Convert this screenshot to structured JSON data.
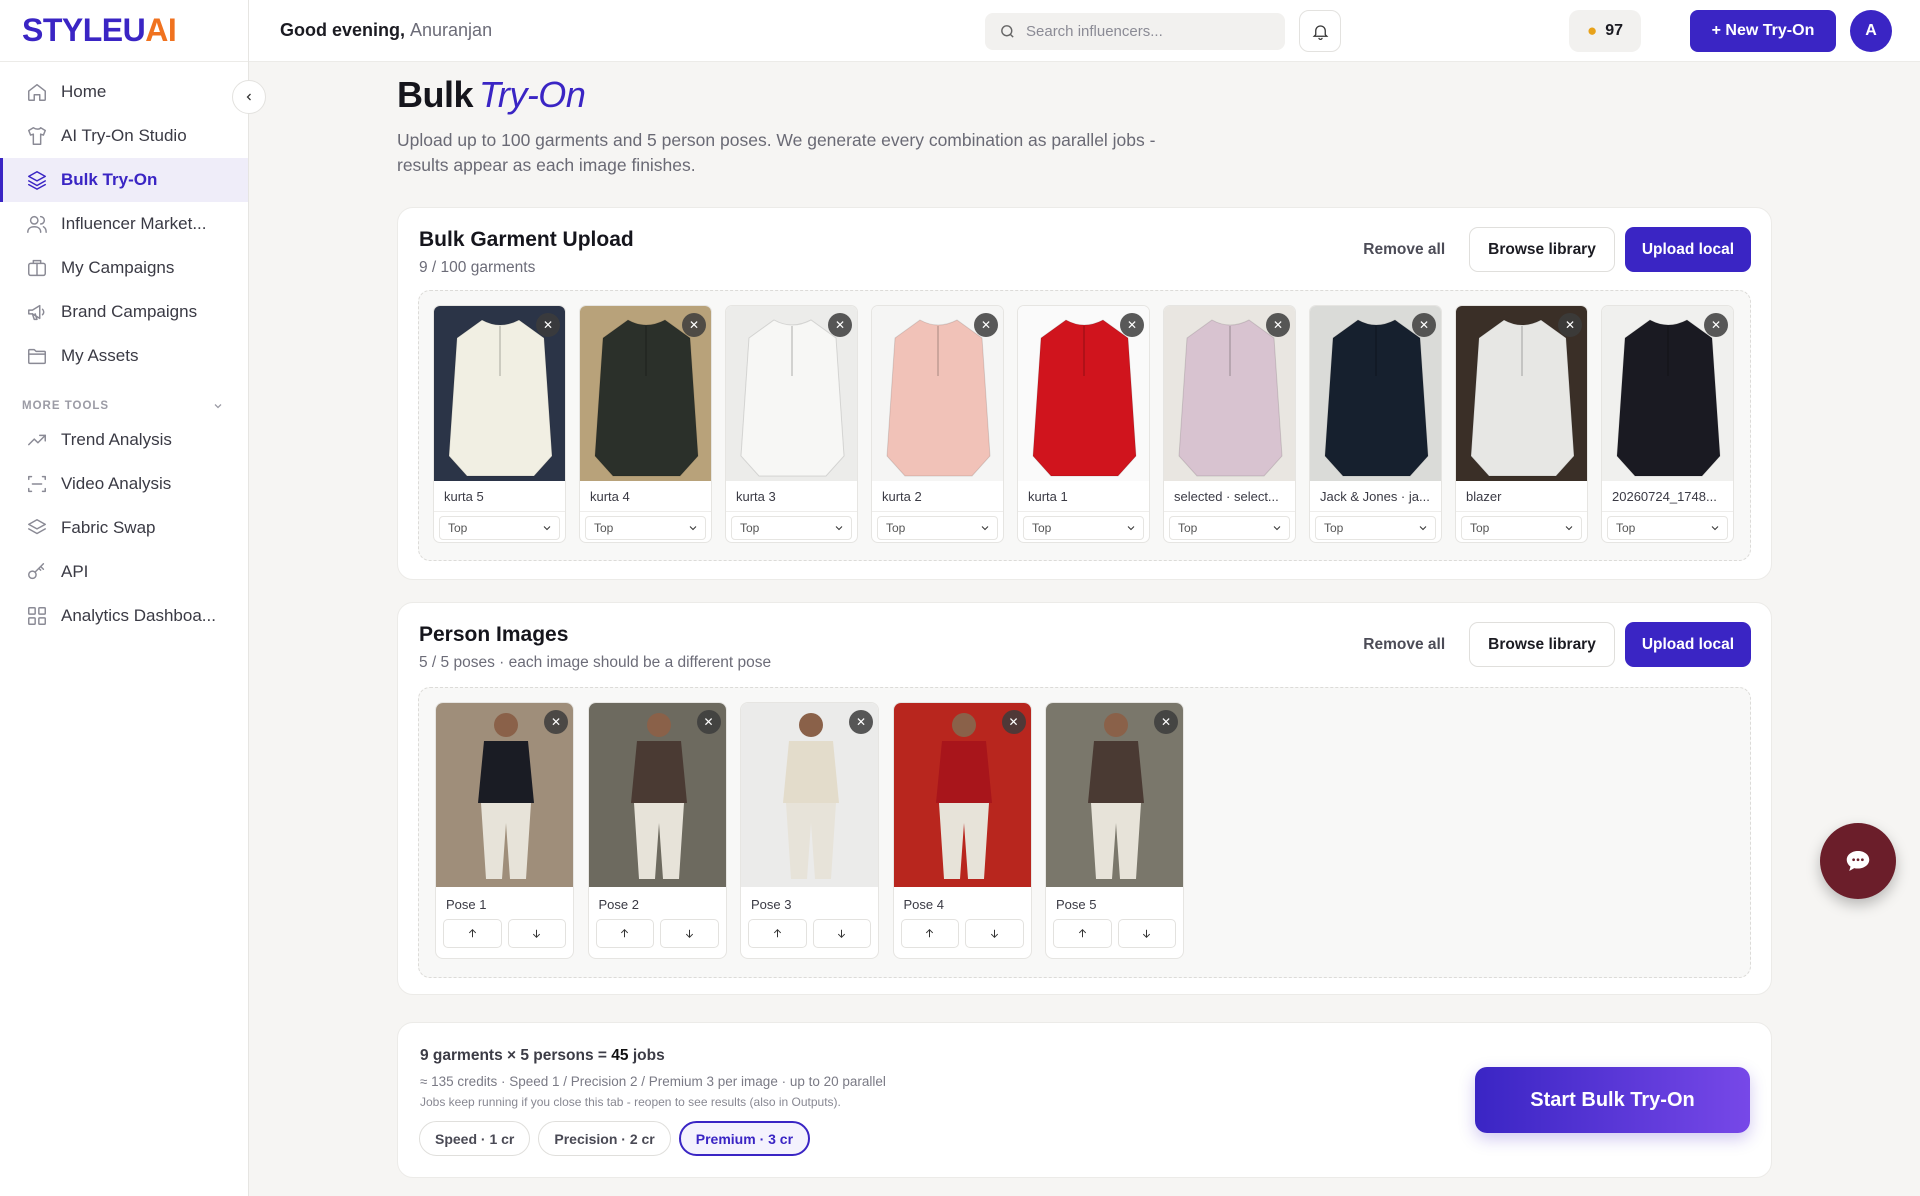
{
  "brand": {
    "part1": "STYLEU",
    "part2": "AI"
  },
  "sidebar": {
    "items": [
      {
        "label": "Home",
        "icon": "home-icon"
      },
      {
        "label": "AI Try-On Studio",
        "icon": "shirt-icon"
      },
      {
        "label": "Bulk Try-On",
        "icon": "layers-icon",
        "active": true
      },
      {
        "label": "Influencer Market...",
        "icon": "users-icon"
      },
      {
        "label": "My Campaigns",
        "icon": "briefcase-icon"
      },
      {
        "label": "Brand Campaigns",
        "icon": "megaphone-icon"
      },
      {
        "label": "My Assets",
        "icon": "folder-icon"
      }
    ],
    "section_label": "MORE TOOLS",
    "tools": [
      {
        "label": "Trend Analysis",
        "icon": "trend-icon"
      },
      {
        "label": "Video Analysis",
        "icon": "scan-icon"
      },
      {
        "label": "Fabric Swap",
        "icon": "layers-icon"
      },
      {
        "label": "API",
        "icon": "key-icon"
      },
      {
        "label": "Analytics Dashboa...",
        "icon": "grid-icon"
      }
    ]
  },
  "topbar": {
    "greeting": "Good evening,",
    "user_name": "Anuranjan",
    "search_placeholder": "Search influencers...",
    "credits": "97",
    "new_button": "+ New Try-On",
    "avatar_initial": "A"
  },
  "page": {
    "title": "Bulk",
    "title_accent": "Try-On",
    "subtitle": "Upload up to 100 garments and 5 person poses. We generate every combination as parallel jobs - results appear as each image finishes."
  },
  "garments": {
    "title": "Bulk Garment Upload",
    "count": "9 / 100 garments",
    "remove_all": "Remove all",
    "browse": "Browse library",
    "upload": "Upload local",
    "items": [
      {
        "name": "kurta 5",
        "type": "Top",
        "color": "#f1efe3",
        "bg": "#2b3447"
      },
      {
        "name": "kurta 4",
        "type": "Top",
        "color": "#2b302a",
        "bg": "#b8a27a"
      },
      {
        "name": "kurta 3",
        "type": "Top",
        "color": "#f7f7f5",
        "bg": "#ececea"
      },
      {
        "name": "kurta 2",
        "type": "Top",
        "color": "#f1c2b8",
        "bg": "#f5f5f4"
      },
      {
        "name": "kurta 1",
        "type": "Top",
        "color": "#d0141d",
        "bg": "#fafafa"
      },
      {
        "name": "selected · select...",
        "type": "Top",
        "color": "#d8c3d0",
        "bg": "#e9e6e1"
      },
      {
        "name": "Jack & Jones · ja...",
        "type": "Top",
        "color": "#16202e",
        "bg": "#dadbd8"
      },
      {
        "name": "blazer",
        "type": "Top",
        "color": "#e7e7e4",
        "bg": "#3a2f27"
      },
      {
        "name": "20260724_1748...",
        "type": "Top",
        "color": "#1a1a22",
        "bg": "#f0f0ee"
      }
    ]
  },
  "persons": {
    "title": "Person Images",
    "count": "5 / 5 poses · each image should be a different pose",
    "remove_all": "Remove all",
    "browse": "Browse library",
    "upload": "Upload local",
    "items": [
      {
        "name": "Pose 1",
        "shirt": "#1a1c24",
        "bg": "#9f8e7a"
      },
      {
        "name": "Pose 2",
        "shirt": "#4a3a33",
        "bg": "#6d6a5f"
      },
      {
        "name": "Pose 3",
        "shirt": "#e3dccb",
        "bg": "#ebebea"
      },
      {
        "name": "Pose 4",
        "shirt": "#a8151b",
        "bg": "#b8261e"
      },
      {
        "name": "Pose 5",
        "shirt": "#4a3a33",
        "bg": "#7a776b"
      }
    ]
  },
  "summary": {
    "line1_prefix": "9 garments × 5 persons =",
    "jobs_count": "45",
    "line1_suffix": "jobs",
    "line2": "≈ 135 credits · Speed 1 / Precision 2 / Premium 3 per image · up to 20 parallel",
    "line3": "Jobs keep running if you close this tab - reopen to see results (also in Outputs).",
    "tiers": [
      {
        "label": "Speed · 1 cr",
        "active": false
      },
      {
        "label": "Precision · 2 cr",
        "active": false
      },
      {
        "label": "Premium · 3 cr",
        "active": true
      }
    ],
    "start_button": "Start Bulk Try-On"
  }
}
